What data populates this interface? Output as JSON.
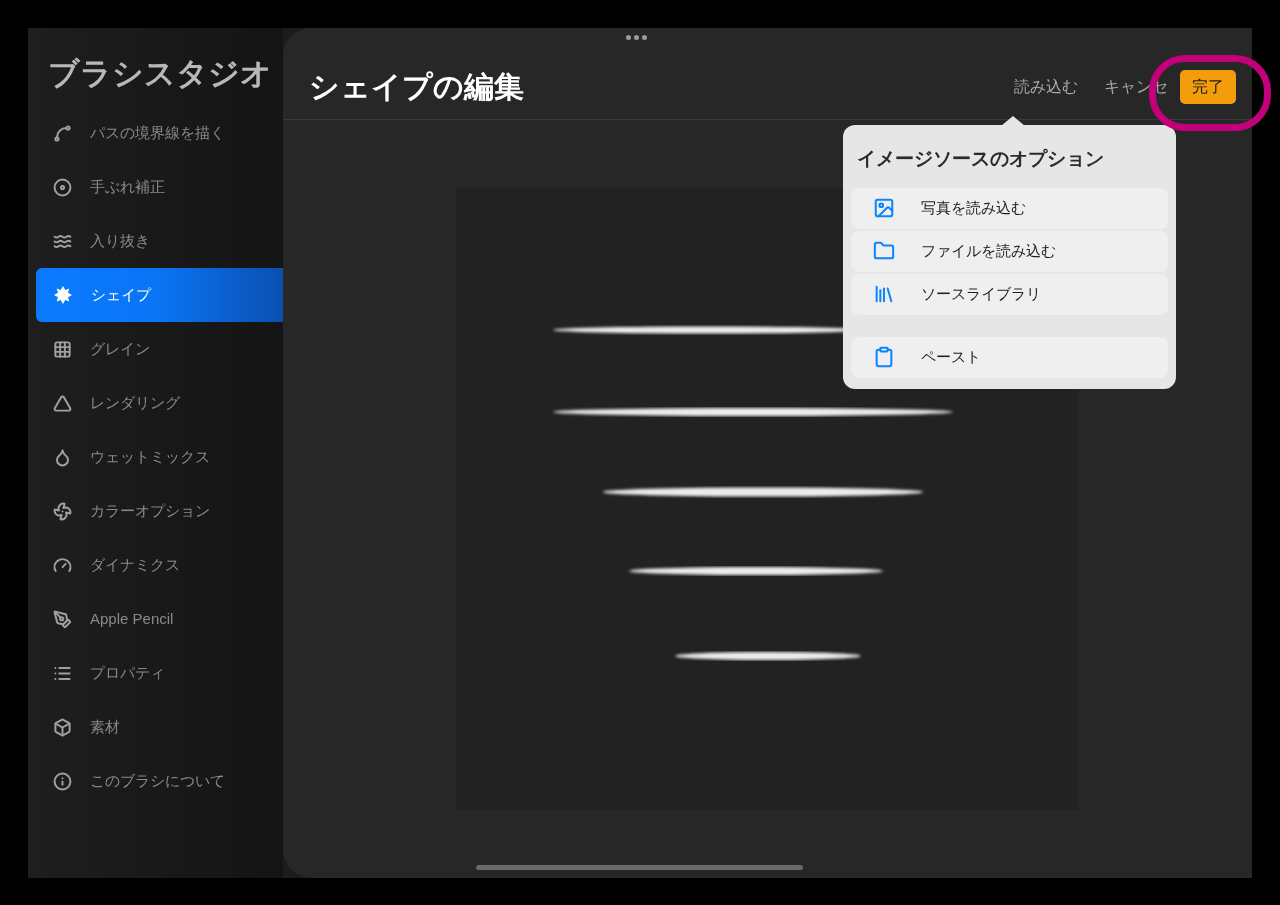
{
  "sidebar": {
    "title": "ブラシスタジオ",
    "items": [
      {
        "label": "パスの境界線を描く",
        "selected": false
      },
      {
        "label": "手ぶれ補正",
        "selected": false
      },
      {
        "label": "入り抜き",
        "selected": false
      },
      {
        "label": "シェイプ",
        "selected": true
      },
      {
        "label": "グレイン",
        "selected": false
      },
      {
        "label": "レンダリング",
        "selected": false
      },
      {
        "label": "ウェットミックス",
        "selected": false
      },
      {
        "label": "カラーオプション",
        "selected": false
      },
      {
        "label": "ダイナミクス",
        "selected": false
      },
      {
        "label": "Apple Pencil",
        "selected": false
      },
      {
        "label": "プロパティ",
        "selected": false
      },
      {
        "label": "素材",
        "selected": false
      },
      {
        "label": "このブラシについて",
        "selected": false
      }
    ]
  },
  "editor": {
    "title": "シェイプの編集",
    "import_button": "読み込む",
    "cancel_button": "キャンセ",
    "done_button": "完了"
  },
  "popover": {
    "title": "イメージソースのオプション",
    "items": [
      {
        "label": "写真を読み込む",
        "kind": "photo"
      },
      {
        "label": "ファイルを読み込む",
        "kind": "file"
      },
      {
        "label": "ソースライブラリ",
        "kind": "library"
      },
      {
        "label": "ペースト",
        "kind": "paste"
      }
    ]
  }
}
